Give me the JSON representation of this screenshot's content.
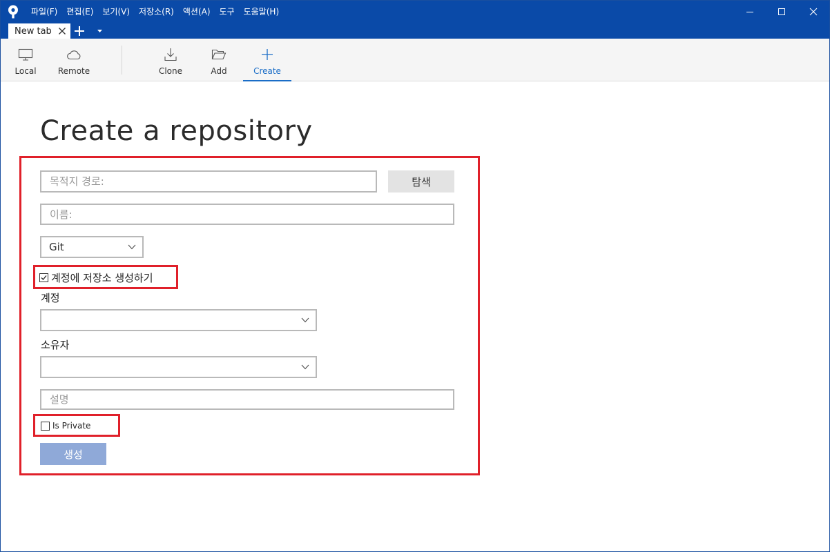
{
  "menu": [
    "파일(F)",
    "편집(E)",
    "보기(V)",
    "저장소(R)",
    "액션(A)",
    "도구",
    "도움말(H)"
  ],
  "tab": {
    "label": "New tab"
  },
  "toolbar": {
    "local": "Local",
    "remote": "Remote",
    "clone": "Clone",
    "add": "Add",
    "create": "Create"
  },
  "page": {
    "title": "Create a repository"
  },
  "form": {
    "dest_placeholder": "목적지 경로:",
    "browse_label": "탐색",
    "name_placeholder": "이름:",
    "vcs_value": "Git",
    "create_remote_label": "계정에 저장소 생성하기",
    "create_remote_checked": true,
    "account_label": "계정",
    "account_value": "",
    "owner_label": "소유자",
    "owner_value": "",
    "description_placeholder": "설명",
    "private_label": "Is Private",
    "private_checked": false,
    "create_button": "생성"
  },
  "colors": {
    "titlebar": "#0a4aa8",
    "accent": "#1a6dc7",
    "highlight": "#e0202a",
    "create_button": "#8fa9d8"
  },
  "icons": {
    "logo": "sourcetree-logo-icon",
    "local": "monitor-icon",
    "remote": "cloud-icon",
    "clone": "download-icon",
    "add": "folder-open-icon",
    "create": "plus-icon"
  }
}
